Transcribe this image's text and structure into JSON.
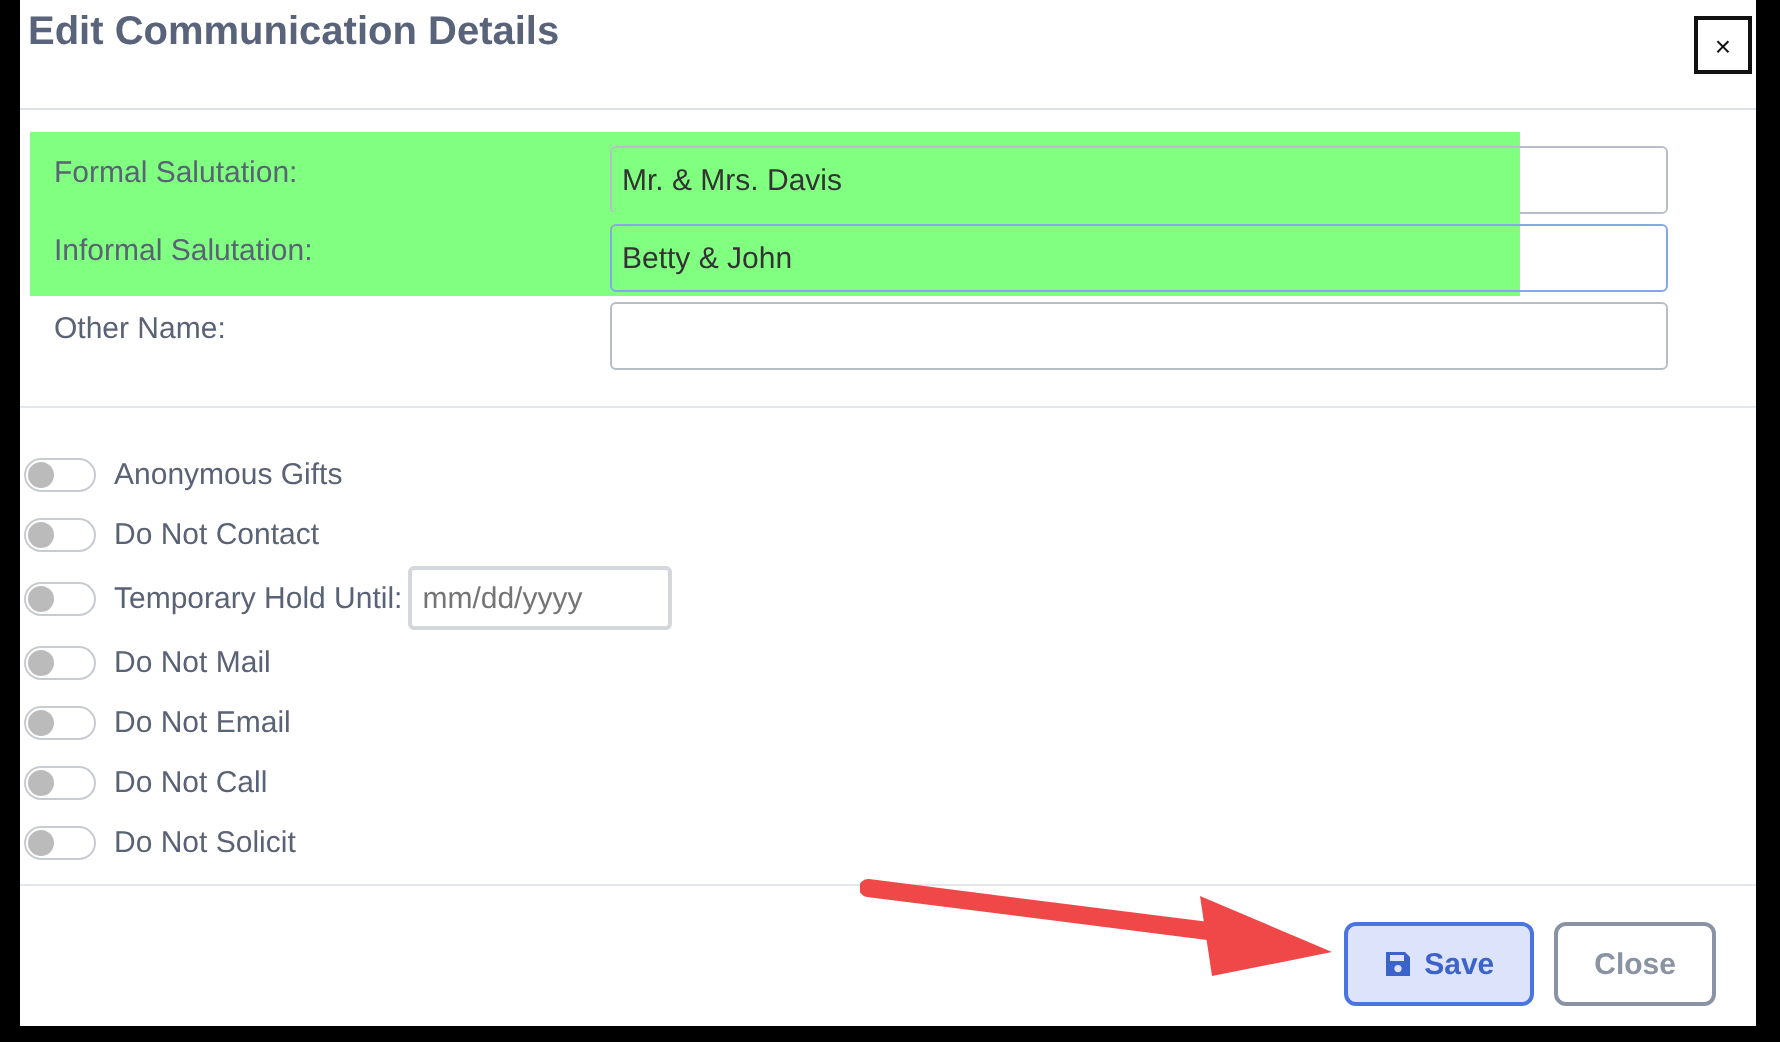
{
  "dialog": {
    "title": "Edit Communication Details",
    "close_label": "×"
  },
  "fields": [
    {
      "label": "Formal Salutation:",
      "value": "Mr. & Mrs. Davis",
      "highlighted": true,
      "focused": false
    },
    {
      "label": "Informal Salutation:",
      "value": "Betty & John",
      "highlighted": true,
      "focused": true
    },
    {
      "label": "Other Name:",
      "highlighted": false,
      "focused": false
    }
  ],
  "toggles": [
    {
      "kind": "toggle",
      "label": "Anonymous Gifts",
      "on": false
    },
    {
      "kind": "toggle",
      "label": "Do Not Contact",
      "on": false
    },
    {
      "kind": "toggle-date",
      "label": "Temporary Hold Until:",
      "on": false,
      "placeholder": "mm/dd/yyyy"
    },
    {
      "kind": "toggle",
      "label": "Do Not Mail",
      "on": false
    },
    {
      "kind": "toggle",
      "label": "Do Not Email",
      "on": false
    },
    {
      "kind": "toggle",
      "label": "Do Not Call",
      "on": false
    },
    {
      "kind": "toggle",
      "label": "Do Not Solicit",
      "on": false
    }
  ],
  "buttons": [
    {
      "kind": "save",
      "label": "Save",
      "selected": true
    },
    {
      "kind": "close",
      "label": "Close",
      "selected": false
    }
  ]
}
